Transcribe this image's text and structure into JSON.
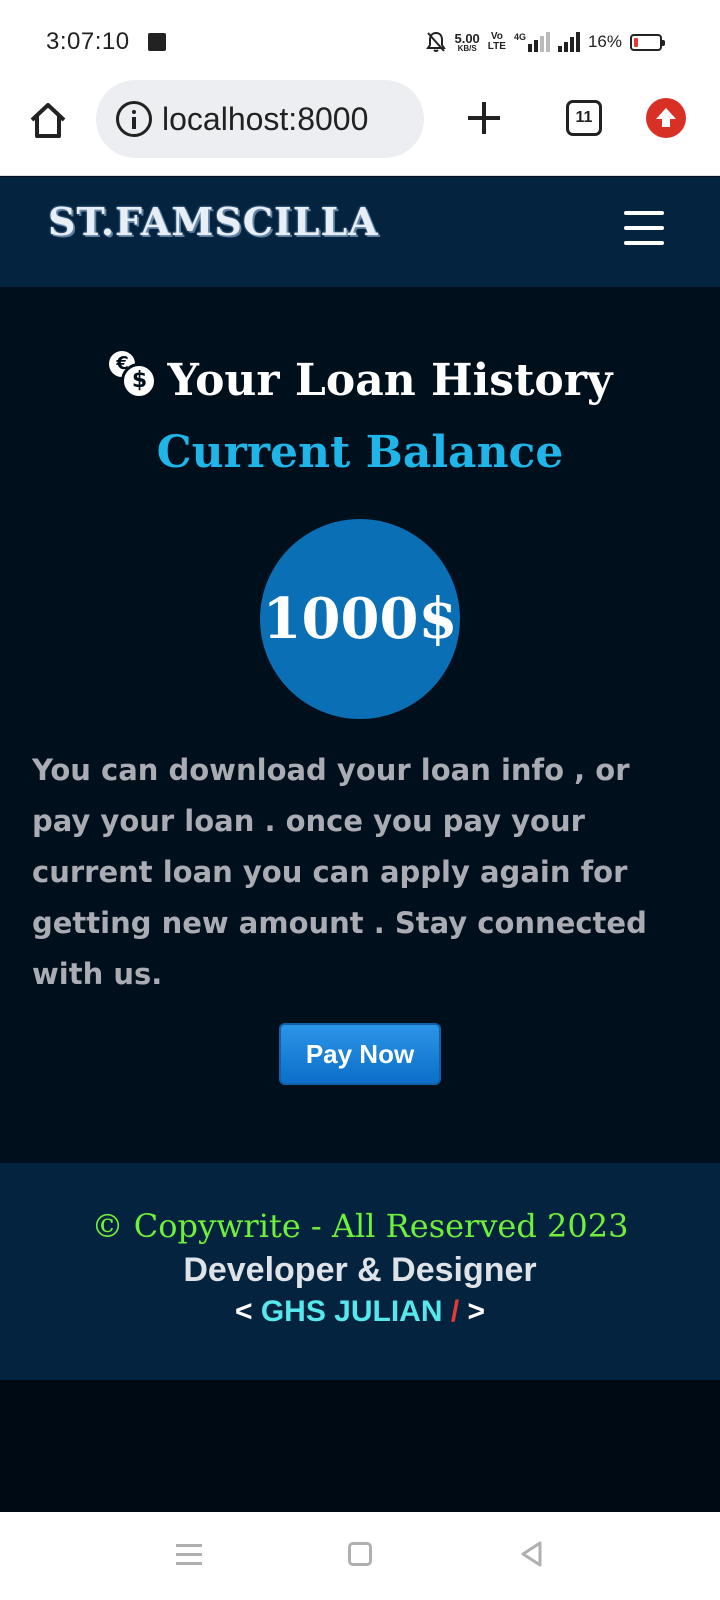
{
  "status_bar": {
    "time": "3:07:10",
    "speed_value": "5.00",
    "speed_unit": "KB/S",
    "volte_top": "Vo",
    "volte_bottom": "LTE",
    "network": "4G",
    "battery": "16%"
  },
  "browser": {
    "url": "localhost:8000",
    "tab_count": "11",
    "icons": [
      "home-icon",
      "info-icon",
      "plus-icon",
      "tabs-icon",
      "update-icon"
    ]
  },
  "navbar": {
    "brand": "ST.FAMSCILLA",
    "menu_icon": "hamburger-icon"
  },
  "main": {
    "heading": "Your Loan History",
    "heading_icon": "coins-icon",
    "coin_small": "€",
    "coin_large": "$",
    "subheading": "Current Balance",
    "balance": "1000$",
    "description": "You can download your loan info , or pay your loan . once you pay your current loan you can apply again for getting new amount . Stay connected with us.",
    "pay_button": "Pay Now"
  },
  "footer": {
    "copyright": "© Copywrite - All Reserved 2023",
    "role": "Developer & Designer",
    "credit_open": "<",
    "credit_name": "GHS JULIAN",
    "credit_slash": "/",
    "credit_close": ">"
  },
  "colors": {
    "page_bg": "#000f1c",
    "nav_bg": "#03233f",
    "accent_cyan": "#1fb5e8",
    "balance_circle": "#0a6fb5",
    "copyright_green": "#6ff03a",
    "credit_cyan": "#57e8ee",
    "slash_red": "#e53935"
  }
}
